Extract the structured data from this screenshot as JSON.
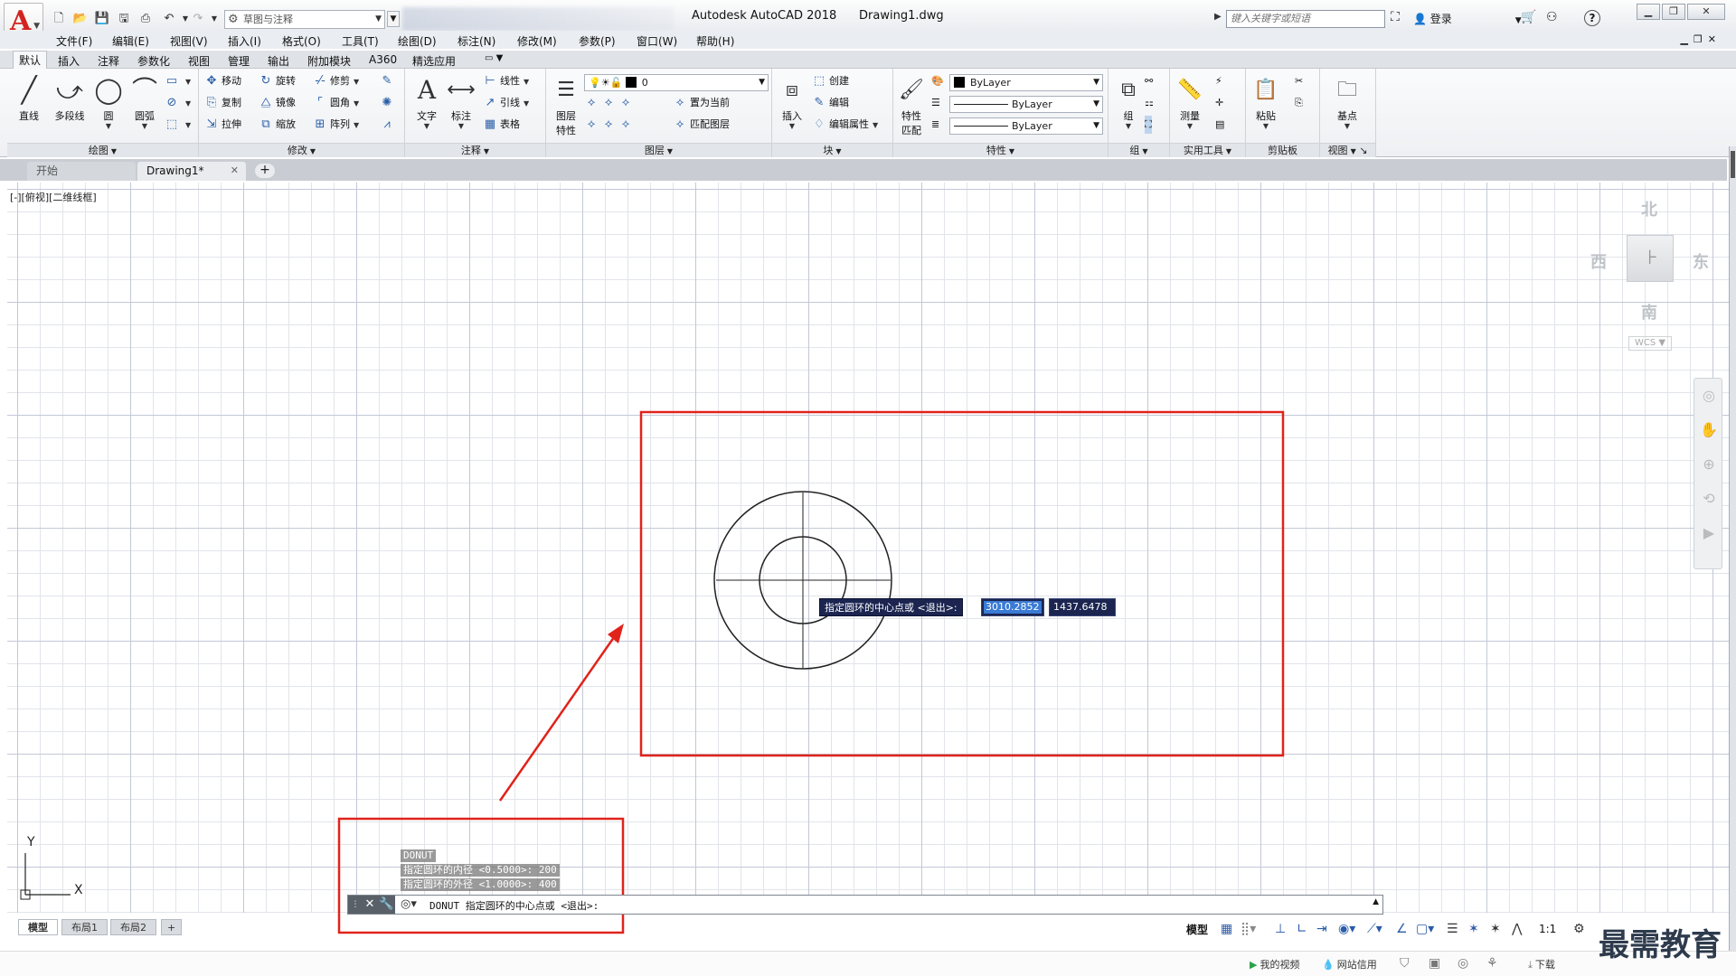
{
  "window": {
    "title": "Autodesk AutoCAD 2018      Drawing1.dwg",
    "logo_letter": "A"
  },
  "quick_access": {
    "workspace": "草图与注释",
    "icons": [
      "new-icon",
      "open-icon",
      "save-icon",
      "saveas-icon",
      "print-icon",
      "undo-icon",
      "redo-icon"
    ]
  },
  "search": {
    "placeholder": "键入关键字或短语"
  },
  "user": {
    "login_label": "登录"
  },
  "menu": [
    "文件(F)",
    "编辑(E)",
    "视图(V)",
    "插入(I)",
    "格式(O)",
    "工具(T)",
    "绘图(D)",
    "标注(N)",
    "修改(M)",
    "参数(P)",
    "窗口(W)",
    "帮助(H)"
  ],
  "ribbon_tabs": [
    "默认",
    "插入",
    "注释",
    "参数化",
    "视图",
    "管理",
    "输出",
    "附加模块",
    "A360",
    "精选应用"
  ],
  "ribbon": {
    "draw": {
      "title": "绘图",
      "line": "直线",
      "polyline": "多段线",
      "circle": "圆",
      "arc": "圆弧"
    },
    "modify": {
      "title": "修改",
      "items": [
        "移动",
        "旋转",
        "修剪",
        "复制",
        "镜像",
        "圆角",
        "拉伸",
        "缩放",
        "阵列"
      ]
    },
    "annotate": {
      "title": "注释",
      "text": "文字",
      "dimension": "标注",
      "linear": "线性",
      "leader": "引线",
      "table": "表格"
    },
    "layers": {
      "title": "图层",
      "props": "图层",
      "props2": "特性",
      "current_layer": "0",
      "set_current": "置为当前",
      "match_layer": "匹配图层"
    },
    "block": {
      "title": "块",
      "insert": "插入",
      "create": "创建",
      "edit": "编辑",
      "edit_attr": "编辑属性"
    },
    "properties": {
      "title": "特性",
      "match": "特性",
      "match2": "匹配",
      "color": "ByLayer",
      "linetype": "ByLayer",
      "lineweight": "ByLayer"
    },
    "groups": {
      "title": "组",
      "group": "组"
    },
    "utilities": {
      "title": "实用工具",
      "measure": "测量"
    },
    "clipboard": {
      "title": "剪贴板",
      "paste": "粘贴"
    },
    "view": {
      "title": "视图",
      "base": "基点"
    }
  },
  "doc_tabs": {
    "start": "开始",
    "drawing": "Drawing1*"
  },
  "viewport": {
    "label": "[-][俯视][二维线框]"
  },
  "viewcube": {
    "north": "北",
    "south": "南",
    "east": "东",
    "west": "西",
    "wcs": "WCS"
  },
  "dynamic_input": {
    "prompt": "指定圆环的中心点或 <退出>:",
    "x_value": "3010.2852",
    "y_value": "1437.6478"
  },
  "ucs": {
    "x": "X",
    "y": "Y"
  },
  "command_history": [
    "DONUT",
    "指定圆环的内径 <0.5000>: 200",
    "指定圆环的外径 <1.0000>: 400"
  ],
  "command_line": {
    "text": "DONUT 指定圆环的中心点或 <退出>:"
  },
  "layout_tabs": [
    "模型",
    "布局1",
    "布局2"
  ],
  "status": {
    "model": "模型",
    "scale": "1:1"
  },
  "taskbar": {
    "video": "我的视频",
    "credit": "网站信用",
    "download": "下载"
  },
  "watermark": "最需教育",
  "colors": {
    "accent_red": "#e0231b",
    "tooltip_bg": "#1b2550",
    "highlight": "#3a7bd5"
  }
}
